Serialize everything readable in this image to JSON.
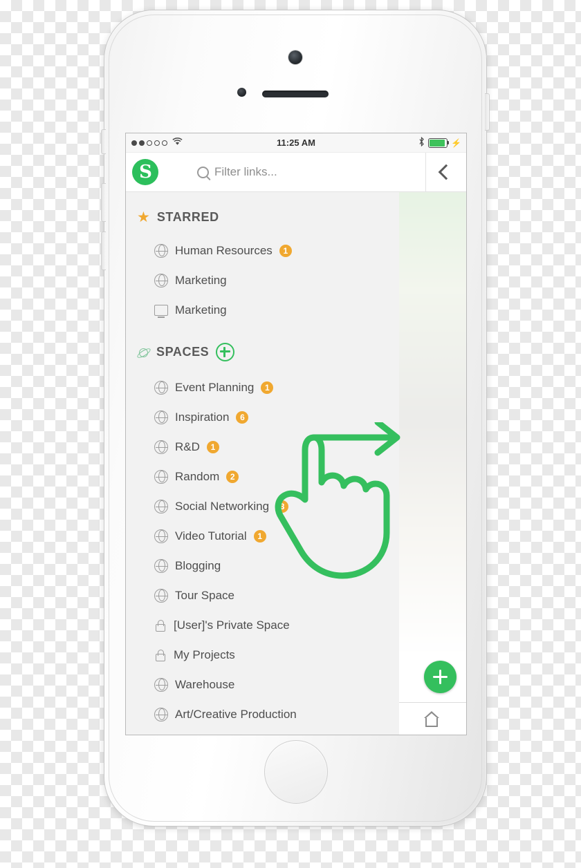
{
  "status_bar": {
    "signal_dots_filled": 2,
    "signal_dots_total": 5,
    "wifi_icon": "wifi-icon",
    "time": "11:25 AM",
    "bluetooth_icon": "bluetooth-icon",
    "battery_icon": "battery-full-icon",
    "charging_icon": "lightning-bolt-icon"
  },
  "nav": {
    "logo_letter": "S",
    "search_placeholder": "Filter links...",
    "search_value": "",
    "back_icon": "chevron-left-icon"
  },
  "sections": [
    {
      "title": "STARRED",
      "icon": "star-icon",
      "has_add": false,
      "items": [
        {
          "label": "Human Resources",
          "icon": "globe-icon",
          "badge": "1"
        },
        {
          "label": "Marketing",
          "icon": "globe-icon",
          "badge": ""
        },
        {
          "label": "Marketing",
          "icon": "monitor-icon",
          "badge": ""
        }
      ]
    },
    {
      "title": "SPACES",
      "icon": "planet-icon",
      "has_add": true,
      "add_icon": "plus-circle-icon",
      "items": [
        {
          "label": "Event Planning",
          "icon": "globe-icon",
          "badge": "1"
        },
        {
          "label": "Inspiration",
          "icon": "globe-icon",
          "badge": "6"
        },
        {
          "label": "R&D",
          "icon": "globe-icon",
          "badge": "1"
        },
        {
          "label": "Random",
          "icon": "globe-icon",
          "badge": "2"
        },
        {
          "label": "Social Networking",
          "icon": "globe-icon",
          "badge": "3"
        },
        {
          "label": "Video Tutorial",
          "icon": "globe-icon",
          "badge": "1"
        },
        {
          "label": "Blogging",
          "icon": "globe-icon",
          "badge": ""
        },
        {
          "label": "Tour Space",
          "icon": "globe-icon",
          "badge": ""
        },
        {
          "label": "[User]'s Private Space",
          "icon": "lock-icon",
          "badge": ""
        },
        {
          "label": "My Projects",
          "icon": "lock-icon",
          "badge": ""
        },
        {
          "label": "Warehouse",
          "icon": "globe-icon",
          "badge": ""
        },
        {
          "label": "Art/Creative Production",
          "icon": "globe-icon",
          "badge": ""
        }
      ]
    }
  ],
  "overlay": {
    "gesture": "swipe-right-hand-gesture",
    "color": "#35bf5e"
  },
  "fab": {
    "icon": "plus-icon",
    "color": "#34bf5d"
  },
  "bottom_bar": {
    "icon": "home-icon"
  },
  "colors": {
    "accent_green": "#34bf5d",
    "badge_orange": "#f0a830",
    "star_gold": "#f0a830",
    "panel_grey": "#f2f2f2",
    "text_grey": "#4e4e4e"
  }
}
